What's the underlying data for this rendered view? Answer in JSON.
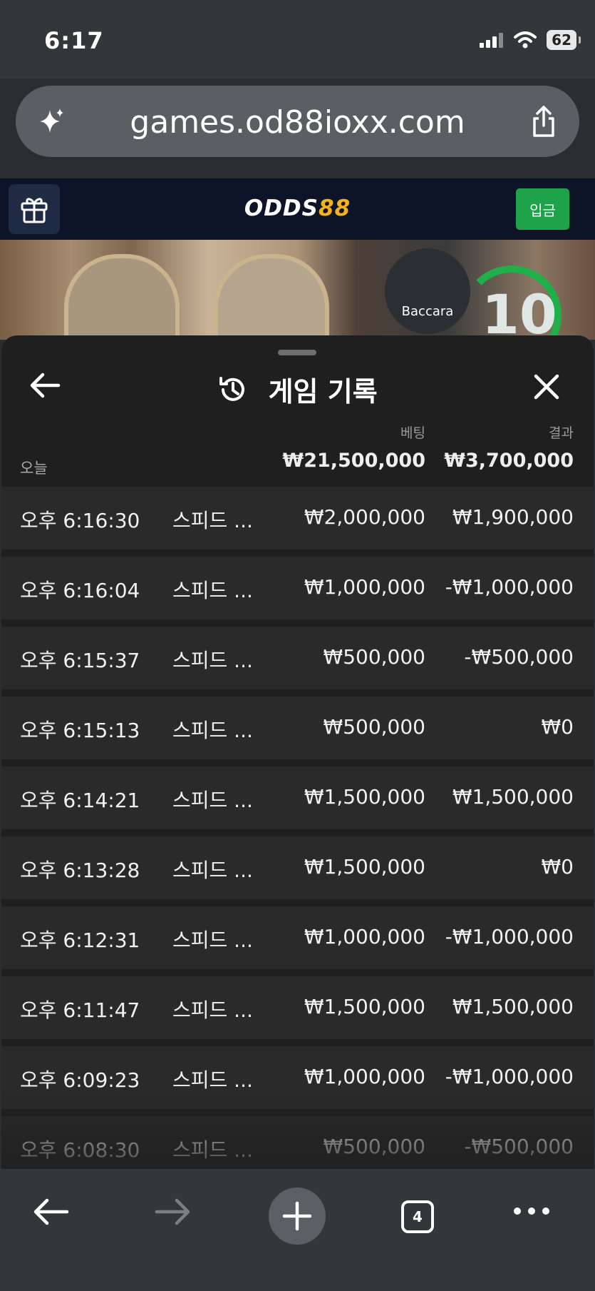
{
  "status_bar": {
    "time": "6:17",
    "battery": "62"
  },
  "browser": {
    "url": "games.od88ioxx.com",
    "tab_count": "4"
  },
  "site": {
    "logo_left": "ODDS",
    "logo_right": "88",
    "deposit_label": "입금"
  },
  "game_banner": {
    "badge": "Baccara",
    "countdown": "10"
  },
  "sheet": {
    "title": "게임 기록",
    "col_bet": "베팅",
    "col_result": "결과",
    "day_label": "오늘",
    "total_bet": "₩21,500,000",
    "total_result": "₩3,700,000",
    "rows": [
      {
        "time": "오후 6:16:30",
        "game": "스피드 ...",
        "bet": "₩2,000,000",
        "result": "₩1,900,000"
      },
      {
        "time": "오후 6:16:04",
        "game": "스피드 ...",
        "bet": "₩1,000,000",
        "result": "-₩1,000,000"
      },
      {
        "time": "오후 6:15:37",
        "game": "스피드 ...",
        "bet": "₩500,000",
        "result": "-₩500,000"
      },
      {
        "time": "오후 6:15:13",
        "game": "스피드 ...",
        "bet": "₩500,000",
        "result": "₩0"
      },
      {
        "time": "오후 6:14:21",
        "game": "스피드 ...",
        "bet": "₩1,500,000",
        "result": "₩1,500,000"
      },
      {
        "time": "오후 6:13:28",
        "game": "스피드 ...",
        "bet": "₩1,500,000",
        "result": "₩0"
      },
      {
        "time": "오후 6:12:31",
        "game": "스피드 ...",
        "bet": "₩1,000,000",
        "result": "-₩1,000,000"
      },
      {
        "time": "오후 6:11:47",
        "game": "스피드 ...",
        "bet": "₩1,500,000",
        "result": "₩1,500,000"
      },
      {
        "time": "오후 6:09:23",
        "game": "스피드 ...",
        "bet": "₩1,000,000",
        "result": "-₩1,000,000"
      },
      {
        "time": "오후 6:08:30",
        "game": "스피드 ...",
        "bet": "₩500,000",
        "result": "-₩500,000"
      }
    ]
  }
}
